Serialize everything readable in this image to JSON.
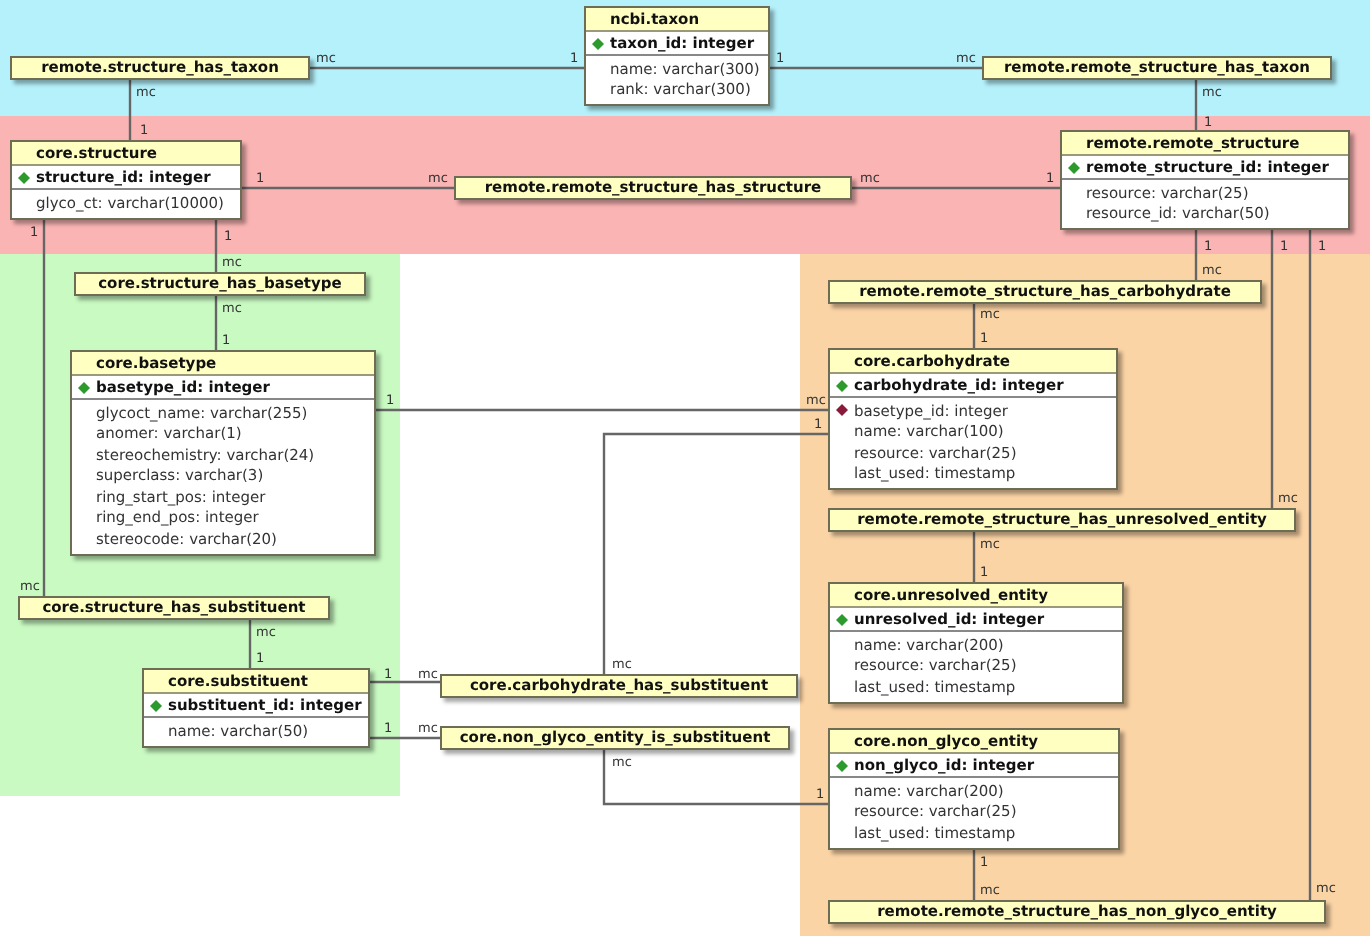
{
  "zones": [
    {
      "color": "#b5f1fb"
    },
    {
      "color": "#fbb4b4"
    },
    {
      "color": "#c9fac2"
    },
    {
      "color": "#fbd4a6"
    }
  ],
  "tables": [
    {
      "kind": "entity",
      "title": "ncbi.taxon",
      "columns": [
        {
          "kind": "primary",
          "text": "taxon_id: integer"
        },
        {
          "kind": "plain",
          "text": "name: varchar(300)"
        },
        {
          "kind": "plain",
          "text": "rank: varchar(300)"
        }
      ]
    },
    {
      "kind": "link",
      "title": "remote.structure_has_taxon"
    },
    {
      "kind": "link",
      "title": "remote.remote_structure_has_taxon"
    },
    {
      "kind": "entity",
      "title": "core.structure",
      "columns": [
        {
          "kind": "primary",
          "text": "structure_id: integer"
        },
        {
          "kind": "plain",
          "text": "glyco_ct: varchar(10000)"
        }
      ]
    },
    {
      "kind": "link",
      "title": "remote.remote_structure_has_structure"
    },
    {
      "kind": "entity",
      "title": "remote.remote_structure",
      "columns": [
        {
          "kind": "primary",
          "text": "remote_structure_id: integer"
        },
        {
          "kind": "plain",
          "text": "resource: varchar(25)"
        },
        {
          "kind": "plain",
          "text": "resource_id: varchar(50)"
        }
      ]
    },
    {
      "kind": "link",
      "title": "core.structure_has_basetype"
    },
    {
      "kind": "link",
      "title": "remote.remote_structure_has_carbohydrate"
    },
    {
      "kind": "entity",
      "title": "core.basetype",
      "columns": [
        {
          "kind": "primary",
          "text": "basetype_id: integer"
        },
        {
          "kind": "plain",
          "text": "glycoct_name: varchar(255)"
        },
        {
          "kind": "plain",
          "text": "anomer: varchar(1)"
        },
        {
          "kind": "plain",
          "text": "stereochemistry: varchar(24)"
        },
        {
          "kind": "plain",
          "text": "superclass: varchar(3)"
        },
        {
          "kind": "plain",
          "text": "ring_start_pos: integer"
        },
        {
          "kind": "plain",
          "text": "ring_end_pos: integer"
        },
        {
          "kind": "plain",
          "text": "stereocode: varchar(20)"
        }
      ]
    },
    {
      "kind": "entity",
      "title": "core.carbohydrate",
      "columns": [
        {
          "kind": "primary",
          "text": "carbohydrate_id: integer"
        },
        {
          "kind": "foreign",
          "text": "basetype_id: integer"
        },
        {
          "kind": "plain",
          "text": "name: varchar(100)"
        },
        {
          "kind": "plain",
          "text": "resource: varchar(25)"
        },
        {
          "kind": "plain",
          "text": "last_used: timestamp"
        }
      ]
    },
    {
      "kind": "link",
      "title": "remote.remote_structure_has_unresolved_entity"
    },
    {
      "kind": "link",
      "title": "core.structure_has_substituent"
    },
    {
      "kind": "entity",
      "title": "core.unresolved_entity",
      "columns": [
        {
          "kind": "primary",
          "text": "unresolved_id: integer"
        },
        {
          "kind": "plain",
          "text": "name: varchar(200)"
        },
        {
          "kind": "plain",
          "text": "resource: varchar(25)"
        },
        {
          "kind": "plain",
          "text": "last_used: timestamp"
        }
      ]
    },
    {
      "kind": "entity",
      "title": "core.substituent",
      "columns": [
        {
          "kind": "primary",
          "text": "substituent_id: integer"
        },
        {
          "kind": "plain",
          "text": "name: varchar(50)"
        }
      ]
    },
    {
      "kind": "link",
      "title": "core.carbohydrate_has_substituent"
    },
    {
      "kind": "link",
      "title": "core.non_glyco_entity_is_substituent"
    },
    {
      "kind": "entity",
      "title": "core.non_glyco_entity",
      "columns": [
        {
          "kind": "primary",
          "text": "non_glyco_id: integer"
        },
        {
          "kind": "plain",
          "text": "name: varchar(200)"
        },
        {
          "kind": "plain",
          "text": "resource: varchar(25)"
        },
        {
          "kind": "plain",
          "text": "last_used: timestamp"
        }
      ]
    },
    {
      "kind": "link",
      "title": "remote.remote_structure_has_non_glyco_entity"
    }
  ],
  "relationships": [
    {
      "end_a": "mc",
      "end_b": "1"
    },
    {
      "end_a": "1",
      "end_b": "mc"
    },
    {
      "end_a": "mc",
      "end_b": "1"
    },
    {
      "end_a": "mc",
      "end_b": "1"
    },
    {
      "end_a": "1",
      "end_b": "mc"
    },
    {
      "end_a": "mc",
      "end_b": "1"
    },
    {
      "end_a": "1",
      "end_b": "mc"
    },
    {
      "end_a": "mc",
      "end_b": "1"
    },
    {
      "end_a": "1",
      "end_b": "mc"
    },
    {
      "end_a": "mc",
      "end_b": "1"
    },
    {
      "end_a": "1",
      "end_b": "mc"
    },
    {
      "end_a": "1",
      "end_b": "mc"
    },
    {
      "end_a": "1",
      "end_b": "mc"
    },
    {
      "end_a": "1",
      "end_b": "mc"
    },
    {
      "end_a": "mc",
      "end_b": "1"
    },
    {
      "end_a": "1",
      "end_b": "mc"
    },
    {
      "end_a": "mc",
      "end_b": "1"
    },
    {
      "end_a": "1",
      "end_b": "mc"
    },
    {
      "end_a": "mc",
      "end_b": "1"
    },
    {
      "end_a": "1",
      "end_b": "mc"
    },
    {
      "end_a": "1",
      "end_b": "mc"
    }
  ]
}
